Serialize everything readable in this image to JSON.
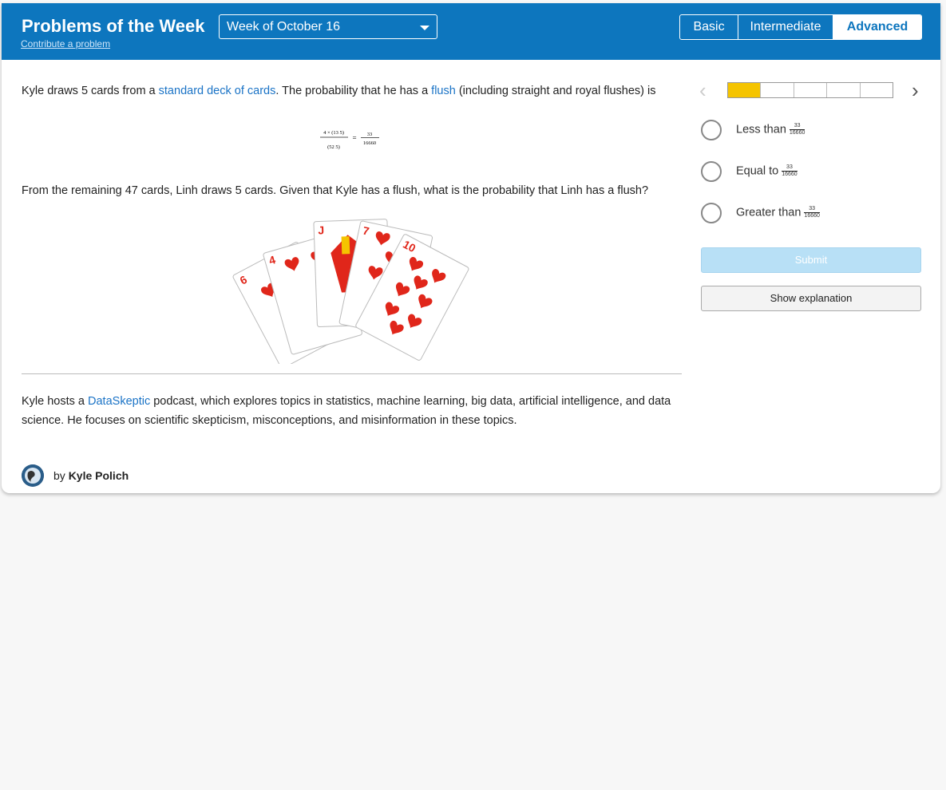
{
  "header": {
    "title": "Problems of the Week",
    "contribute_link": "Contribute a problem",
    "week_select": "Week of October 16",
    "levels": [
      {
        "label": "Basic",
        "active": false
      },
      {
        "label": "Intermediate",
        "active": false
      },
      {
        "label": "Advanced",
        "active": true
      }
    ]
  },
  "problem": {
    "p1_before": "Kyle draws 5 cards from a ",
    "p1_link1": "standard deck of cards",
    "p1_mid": ". The probability that he has a ",
    "p1_link2": "flush",
    "p1_after": " (including straight and royal flushes) is",
    "formula": {
      "numerator": "4 × (13 5)",
      "denominator": "(52 5)",
      "equals": "=",
      "result_num": "33",
      "result_den": "16660"
    },
    "p2": "From the remaining 47 cards, Linh draws 5 cards. Given that Kyle has a flush, what is the probability that Linh has a flush?",
    "card_labels": [
      "6",
      "4",
      "J",
      "7",
      "10"
    ]
  },
  "about": {
    "before": "Kyle hosts a ",
    "link": "DataSkeptic",
    "after": " podcast, which explores topics in statistics, machine learning, big data, artificial intelligence, and data science. He focuses on scientific skepticism, misconceptions, and misinformation in these topics."
  },
  "author": {
    "by": "by",
    "name": "Kyle Polich"
  },
  "progress": {
    "completed": 1,
    "total": 5
  },
  "options": [
    {
      "label": "Less than",
      "frac_num": "33",
      "frac_den": "16660"
    },
    {
      "label": "Equal to",
      "frac_num": "33",
      "frac_den": "16660"
    },
    {
      "label": "Greater than",
      "frac_num": "33",
      "frac_den": "16660"
    }
  ],
  "buttons": {
    "submit": "Submit",
    "explanation": "Show explanation"
  },
  "colors": {
    "header": "#0d76be",
    "accent_link": "#1a73c6",
    "progress": "#f5c400",
    "submit_disabled": "#b8e0f6",
    "heart_red": "#e0261a"
  }
}
